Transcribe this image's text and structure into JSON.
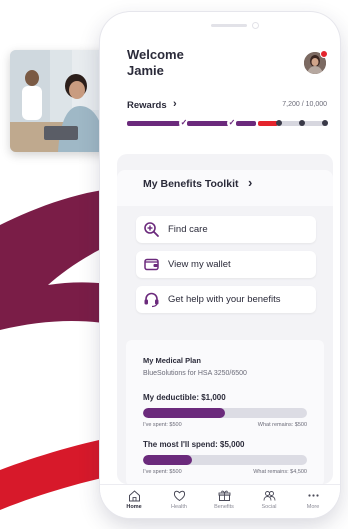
{
  "colors": {
    "brand_purple": "#6b2a7c",
    "rewards_purple": "#6b2a7c",
    "accent_red": "#e4242d",
    "swoosh_red": "#d7192a",
    "swoosh_maroon": "#7a1d47",
    "text_dark": "#2b2b3a",
    "text_muted": "#6b6b78"
  },
  "header": {
    "welcome_line1": "Welcome",
    "welcome_line2": "Jamie",
    "avatar_icon": "user-avatar",
    "notification_icon": "notification-dot"
  },
  "rewards": {
    "label": "Rewards",
    "chevron": "›",
    "points_text": "7,200 / 10,000",
    "progress_fraction": 0.72,
    "check_icon": "✓"
  },
  "toolkit": {
    "title": "My Benefits Toolkit",
    "chevron": "›",
    "actions": [
      {
        "label": "Find care",
        "icon": "search-plus-icon"
      },
      {
        "label": "View my wallet",
        "icon": "wallet-icon"
      },
      {
        "label": "Get help with your benefits",
        "icon": "headset-icon"
      }
    ]
  },
  "plan": {
    "title": "My Medical Plan",
    "subtitle": "BlueSolutions for HSA 3250/6500",
    "deductible": {
      "title": "My deductible: $1,000",
      "spent_label": "I've spent: $500",
      "remains_label": "What remains: $500",
      "progress_fraction": 0.5
    },
    "max_spend": {
      "title": "The most I'll spend: $5,000",
      "spent_label": "I've spent: $500",
      "remains_label": "What remains: $4,500",
      "progress_fraction": 0.3
    }
  },
  "nav": {
    "items": [
      {
        "label": "Home",
        "icon": "home-icon",
        "active": true
      },
      {
        "label": "Health",
        "icon": "heart-icon",
        "active": false
      },
      {
        "label": "Benefits",
        "icon": "benefits-icon",
        "active": false
      },
      {
        "label": "Social",
        "icon": "social-icon",
        "active": false
      },
      {
        "label": "More",
        "icon": "more-icon",
        "active": false
      }
    ]
  }
}
